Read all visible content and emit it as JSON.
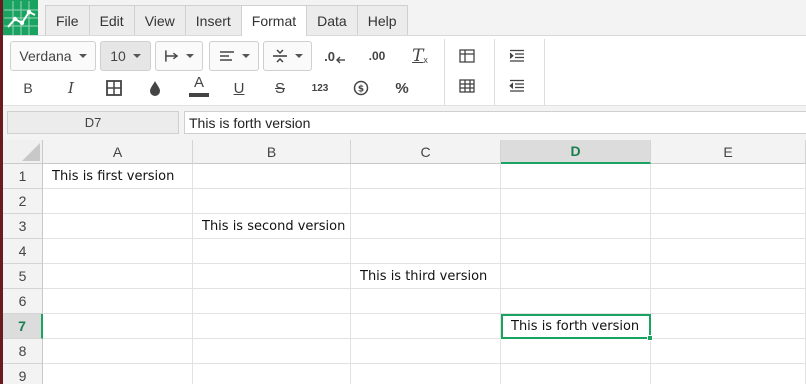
{
  "menu": {
    "tabs": [
      {
        "label": "File"
      },
      {
        "label": "Edit"
      },
      {
        "label": "View"
      },
      {
        "label": "Insert"
      },
      {
        "label": "Format"
      },
      {
        "label": "Data"
      },
      {
        "label": "Help"
      }
    ],
    "active_tab": "Format"
  },
  "toolbar": {
    "font_family": "Verdana",
    "font_size": "10",
    "decimal_decrease_label": ".0",
    "decimal_increase_label": ".00",
    "number_format_label": "123",
    "percent_label": "%",
    "accent_color": "#1aa260"
  },
  "formula_bar": {
    "cell_ref": "D7",
    "value": "This is forth version"
  },
  "sheet": {
    "columns": [
      "A",
      "B",
      "C",
      "D",
      "E"
    ],
    "rows": [
      "1",
      "2",
      "3",
      "4",
      "5",
      "6",
      "7",
      "8",
      "9"
    ],
    "active_cell": "D7",
    "cells": {
      "A1": "This is first version",
      "B3": "This is second version",
      "C5": "This is third version",
      "D7": "This is forth version"
    }
  }
}
